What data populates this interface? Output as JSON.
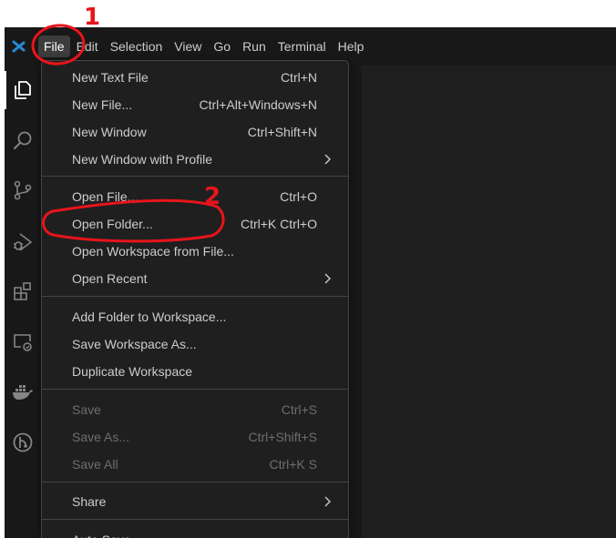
{
  "menubar": {
    "items": [
      {
        "label": "File"
      },
      {
        "label": "Edit"
      },
      {
        "label": "Selection"
      },
      {
        "label": "View"
      },
      {
        "label": "Go"
      },
      {
        "label": "Run"
      },
      {
        "label": "Terminal"
      },
      {
        "label": "Help"
      }
    ]
  },
  "file_menu": {
    "groups": [
      [
        {
          "label": "New Text File",
          "shortcut": "Ctrl+N"
        },
        {
          "label": "New File...",
          "shortcut": "Ctrl+Alt+Windows+N"
        },
        {
          "label": "New Window",
          "shortcut": "Ctrl+Shift+N"
        },
        {
          "label": "New Window with Profile",
          "submenu": true
        }
      ],
      [
        {
          "label": "Open File...",
          "shortcut": "Ctrl+O"
        },
        {
          "label": "Open Folder...",
          "shortcut": "Ctrl+K Ctrl+O"
        },
        {
          "label": "Open Workspace from File..."
        },
        {
          "label": "Open Recent",
          "submenu": true
        }
      ],
      [
        {
          "label": "Add Folder to Workspace..."
        },
        {
          "label": "Save Workspace As..."
        },
        {
          "label": "Duplicate Workspace"
        }
      ],
      [
        {
          "label": "Save",
          "shortcut": "Ctrl+S",
          "disabled": true
        },
        {
          "label": "Save As...",
          "shortcut": "Ctrl+Shift+S",
          "disabled": true
        },
        {
          "label": "Save All",
          "shortcut": "Ctrl+K S",
          "disabled": true
        }
      ],
      [
        {
          "label": "Share",
          "submenu": true
        }
      ],
      [
        {
          "label": "Auto Save"
        }
      ]
    ]
  },
  "activity_icons": [
    "explorer-icon",
    "search-icon",
    "source-control-icon",
    "run-debug-icon",
    "extensions-icon",
    "remote-explorer-icon",
    "docker-icon",
    "gitlens-icon"
  ],
  "annotations": {
    "step1": "1",
    "step2": "2",
    "color": "#e8141b"
  },
  "colors": {
    "logo": "#2a8ad4",
    "menu_bg": "#1f1f1f",
    "text": "#cccccc",
    "disabled_text": "#6e6e6e"
  }
}
